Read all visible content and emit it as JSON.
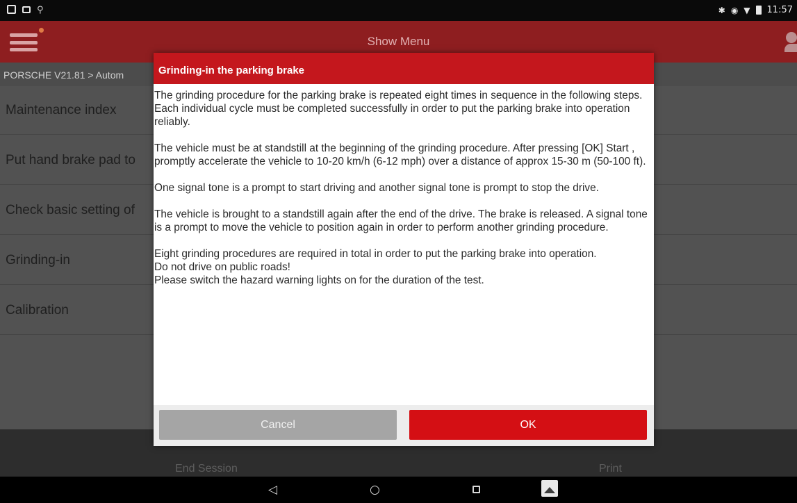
{
  "status_bar": {
    "time": "11:57",
    "icons": [
      "gallery-notification-icon",
      "screen-notification-icon",
      "wifi-signal-icon",
      "bluetooth-icon",
      "sync-icon",
      "wifi-icon",
      "battery-icon"
    ]
  },
  "header": {
    "title": "Show Menu",
    "accent_color": "#8e1e20"
  },
  "breadcrumb": "PORSCHE V21.81 > Autom",
  "list": {
    "items": [
      {
        "label": "Maintenance index"
      },
      {
        "label": "Put hand brake pad to"
      },
      {
        "label": "Check basic setting of"
      },
      {
        "label": "Grinding-in"
      },
      {
        "label": "Calibration"
      }
    ]
  },
  "toolbar": {
    "end_session_label": "End Session",
    "print_label": "Print"
  },
  "navbar": {
    "icons": [
      "back-icon",
      "home-icon",
      "recents-icon",
      "gallery-icon"
    ]
  },
  "dialog": {
    "title": "Grinding-in the parking brake",
    "paragraphs": [
      "The grinding procedure for the parking brake is repeated eight times in sequence in the following steps. Each individual cycle must be completed successfully in order to put the parking brake into operation reliably.",
      "The vehicle must be at standstill at the beginning of the grinding procedure. After pressing [OK] Start , promptly accelerate the vehicle to 10-20 km/h (6-12 mph) over a distance of approx 15-30 m (50-100 ft).",
      "One signal tone is a prompt to start driving and another signal tone is prompt to stop the drive.",
      "The vehicle is brought to a standstill again after the end of the drive. The brake is released. A signal tone is a prompt to move the vehicle to position again in order to perform another grinding procedure."
    ],
    "final_lines": [
      "Eight grinding procedures are required in total in order to put the parking brake into operation.",
      "Do not drive on public roads!",
      "Please switch the hazard warning lights on for the duration of the test."
    ],
    "cancel_label": "Cancel",
    "ok_label": "OK",
    "ok_color": "#d40f14",
    "header_color": "#c4171d"
  }
}
